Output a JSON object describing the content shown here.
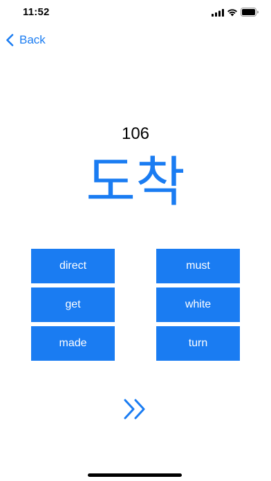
{
  "status_bar": {
    "time": "11:52",
    "icons": [
      "signal-icon",
      "wifi-icon",
      "battery-icon"
    ]
  },
  "nav": {
    "back_label": "Back",
    "back_icon": "chevron-left-icon"
  },
  "card": {
    "number": "106",
    "word": "도착"
  },
  "answers": {
    "left": [
      "direct",
      "get",
      "made"
    ],
    "right": [
      "must",
      "white",
      "turn"
    ]
  },
  "next": {
    "icon": "double-chevron-right-icon"
  },
  "colors": {
    "accent": "#1a7cf2",
    "background": "#ffffff",
    "button_text": "#ffffff"
  }
}
